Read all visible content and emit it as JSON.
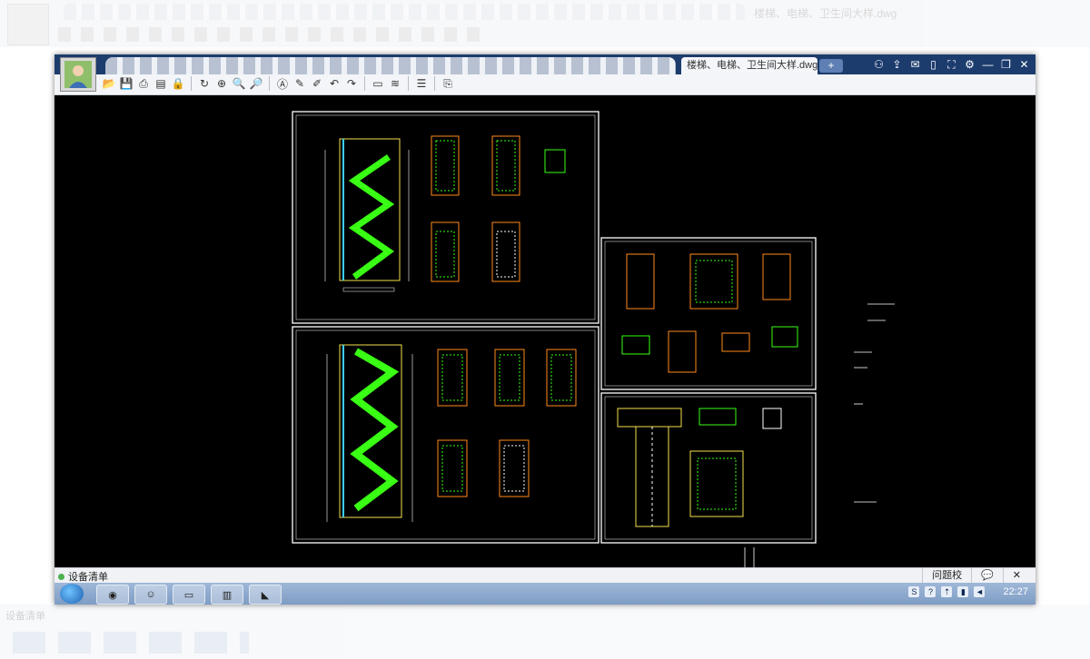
{
  "window": {
    "file_tab": "楼梯、电梯、卫生间大样.dwg",
    "new_tab_label": "+"
  },
  "statusbar": {
    "label": "设备清单",
    "feedback": "问题校",
    "chat_icon": "chat-icon",
    "close": "✕"
  },
  "taskbar": {
    "clock": "22:27"
  },
  "colors": {
    "titlebar": "#1d3c6e",
    "canvas": "#000000",
    "drawing_white": "#ffffff",
    "drawing_green": "#39ff14",
    "drawing_orange": "#ff8a1a",
    "drawing_yellow": "#f4e04d"
  }
}
